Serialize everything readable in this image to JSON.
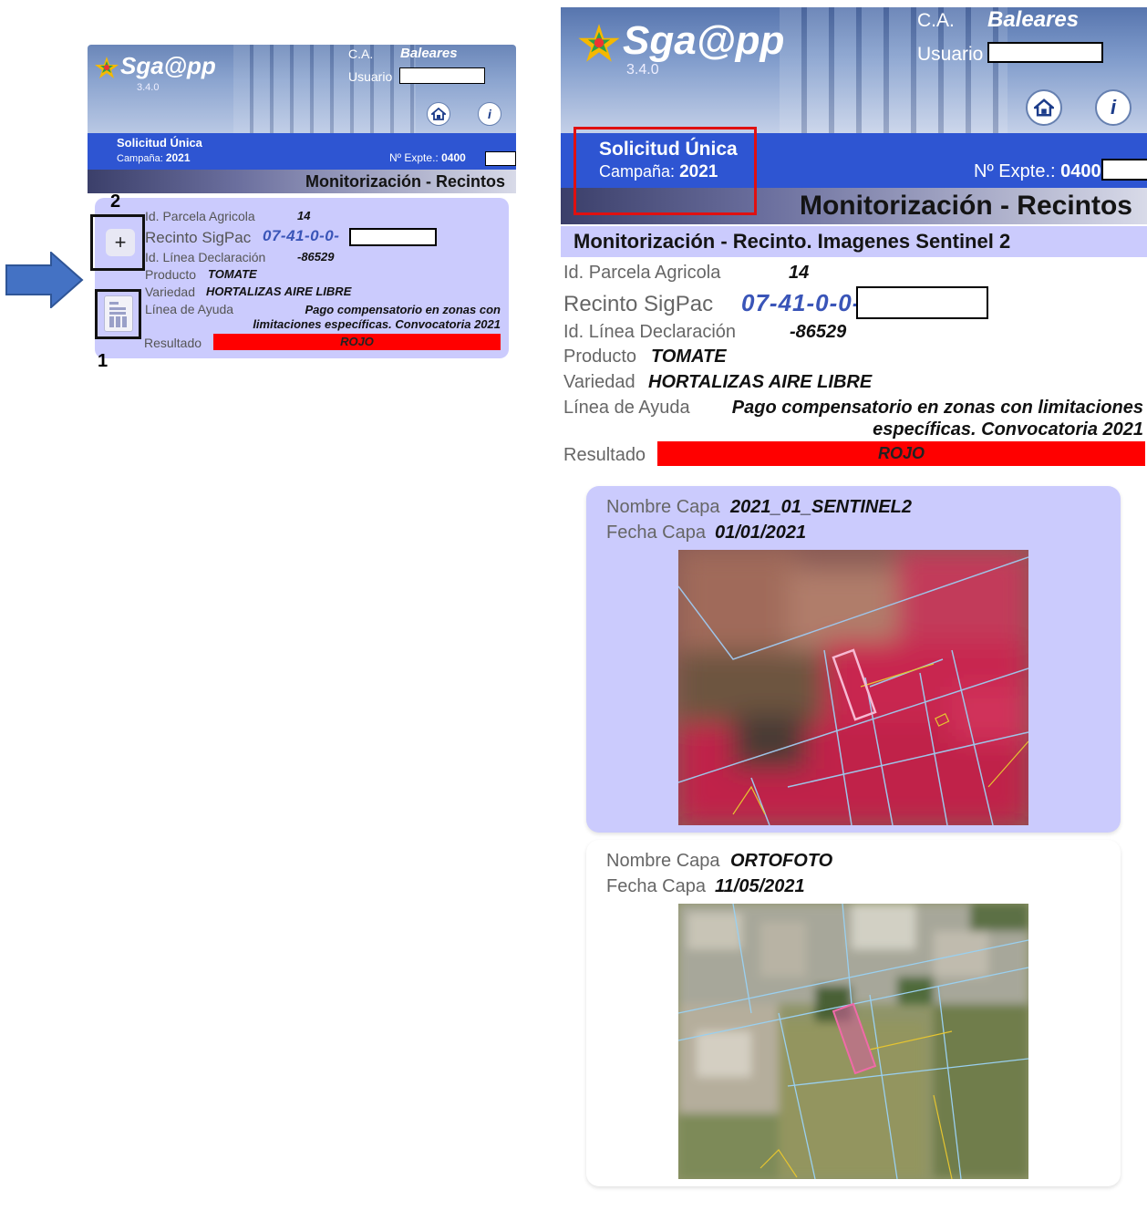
{
  "header": {
    "app_name": "Sga@pp",
    "version": "3.4.0",
    "ca_label": "C.A.",
    "ca_value": "Baleares",
    "user_label": "Usuario",
    "info_icon_glyph": "i"
  },
  "banner": {
    "title": "Solicitud Única",
    "campaign_label": "Campaña:",
    "campaign_value": "2021",
    "expte_label": "Nº Expte.:",
    "expte_value": "0400"
  },
  "section_title": "Monitorización - Recintos",
  "detail_subtitle": "Monitorización - Recinto. Imagenes Sentinel 2",
  "record": {
    "parcela_label": "Id. Parcela Agricola",
    "parcela_value": "14",
    "sigpac_label": "Recinto SigPac",
    "sigpac_value": "07-41-0-0-",
    "linea_label": "Id. Línea Declaración",
    "linea_value": "-86529",
    "producto_label": "Producto",
    "producto_value": "TOMATE",
    "variedad_label": "Variedad",
    "variedad_value": "HORTALIZAS AIRE LIBRE",
    "ayuda_label": "Línea de Ayuda",
    "ayuda_small_line1": "Pago compensatorio en zonas con",
    "ayuda_small_line2": "limitaciones específicas. Convocatoria 2021",
    "ayuda_large_line1": "Pago compensatorio en zonas con limitaciones",
    "ayuda_large_line2": "específicas. Convocatoria 2021",
    "resultado_label": "Resultado",
    "resultado_value": "ROJO"
  },
  "annotations": {
    "marker_1": "1",
    "marker_2": "2",
    "plus_glyph": "+"
  },
  "layers": [
    {
      "name_label": "Nombre Capa",
      "name_value": "2021_01_SENTINEL2",
      "date_label": "Fecha Capa",
      "date_value": "01/01/2021"
    },
    {
      "name_label": "Nombre Capa",
      "name_value": "ORTOFOTO",
      "date_label": "Fecha Capa",
      "date_value": "11/05/2021"
    }
  ],
  "colors": {
    "banner_blue": "#2e55d2",
    "card_lavender": "#cbcbfd",
    "result_red": "#ff0000",
    "arrow_blue": "#4472c4",
    "highlight_red": "#e01010"
  },
  "icons": {
    "home": "home-icon",
    "info": "info-icon",
    "expand": "plus-icon",
    "document": "document-icon"
  }
}
